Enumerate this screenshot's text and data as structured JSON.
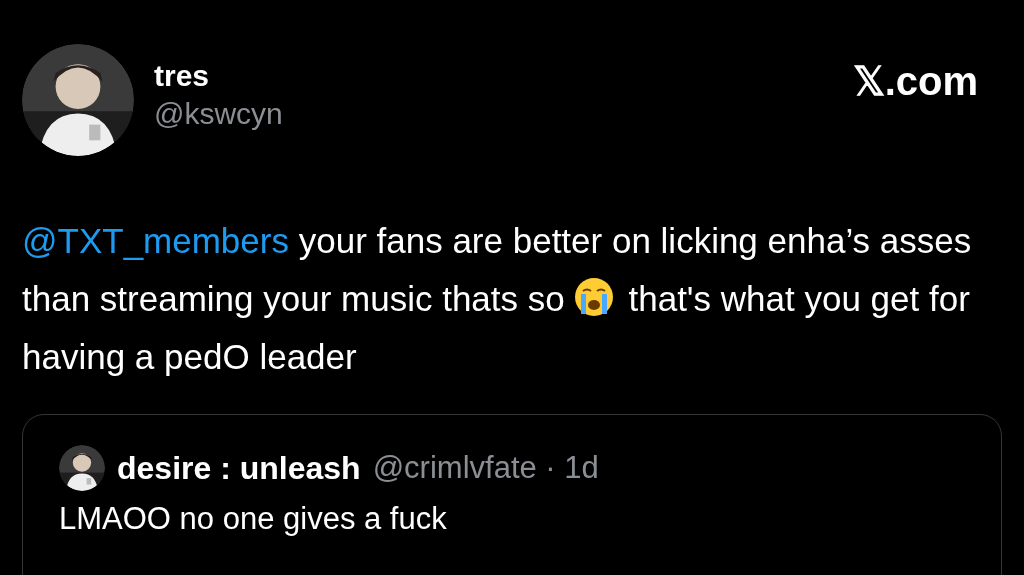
{
  "author": {
    "name": "tres",
    "handle": "@kswcyn"
  },
  "site": "𝕏.com",
  "tweet": {
    "mention": "@TXT_members",
    "text_before_emoji": "your fans are better on licking enha’s asses than streaming your music thats so",
    "text_after_emoji": "that's what you get for having a pedO leader"
  },
  "quote": {
    "name": "desire : unleash",
    "handle": "@crimlvfate",
    "separator": "·",
    "time": "1d",
    "text": "LMAOO no one gives a fuck"
  }
}
